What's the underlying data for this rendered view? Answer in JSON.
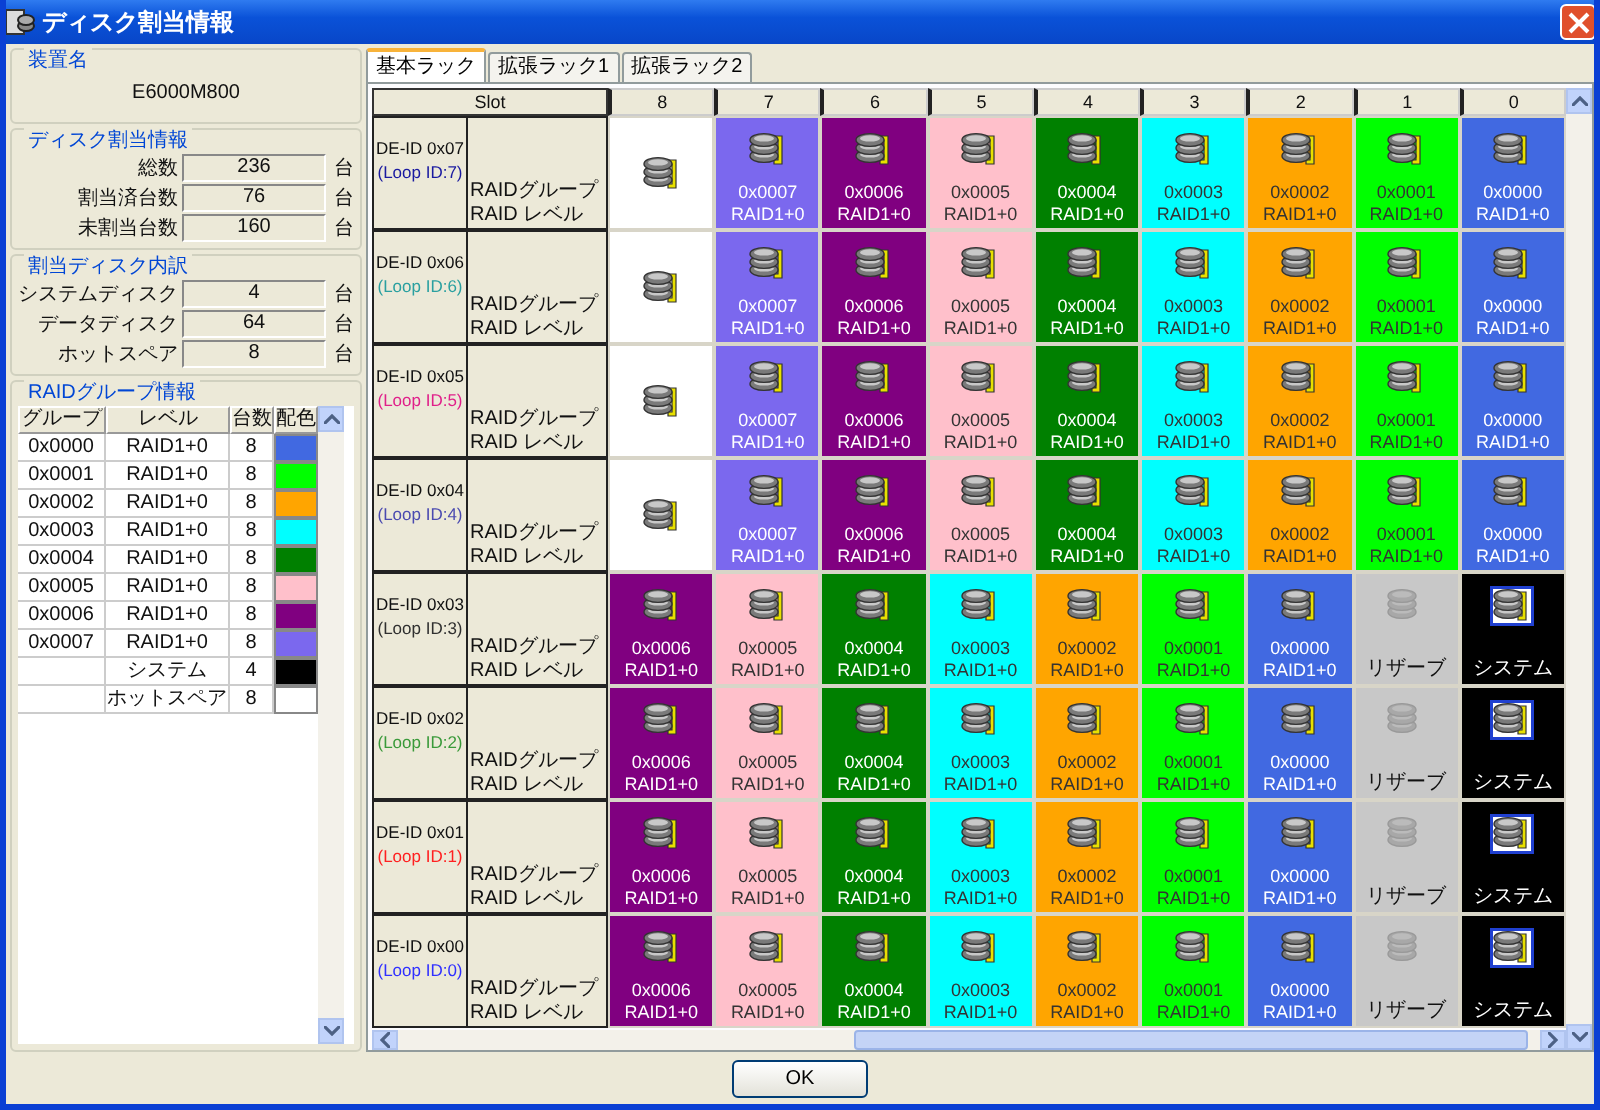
{
  "window": {
    "title": "ディスク割当情報"
  },
  "device": {
    "legend": "装置名",
    "name": "E6000M800"
  },
  "allocation": {
    "legend": "ディスク割当情報",
    "rows": [
      {
        "label": "総数",
        "value": "236",
        "unit": "台"
      },
      {
        "label": "割当済台数",
        "value": "76",
        "unit": "台"
      },
      {
        "label": "未割当台数",
        "value": "160",
        "unit": "台"
      }
    ]
  },
  "breakdown": {
    "legend": "割当ディスク内訳",
    "rows": [
      {
        "label": "システムディスク",
        "value": "4",
        "unit": "台"
      },
      {
        "label": "データディスク",
        "value": "64",
        "unit": "台"
      },
      {
        "label": "ホットスペア",
        "value": "8",
        "unit": "台"
      }
    ]
  },
  "raid_groups": {
    "legend": "RAIDグループ情報",
    "columns": [
      "グループ",
      "レベル",
      "台数",
      "配色"
    ],
    "rows": [
      {
        "group": "0x0000",
        "level": "RAID1+0",
        "count": "8",
        "color": "#4169e1"
      },
      {
        "group": "0x0001",
        "level": "RAID1+0",
        "count": "8",
        "color": "#00ff00"
      },
      {
        "group": "0x0002",
        "level": "RAID1+0",
        "count": "8",
        "color": "#ffa500"
      },
      {
        "group": "0x0003",
        "level": "RAID1+0",
        "count": "8",
        "color": "#00ffff"
      },
      {
        "group": "0x0004",
        "level": "RAID1+0",
        "count": "8",
        "color": "#008000"
      },
      {
        "group": "0x0005",
        "level": "RAID1+0",
        "count": "8",
        "color": "#ffc0cb"
      },
      {
        "group": "0x0006",
        "level": "RAID1+0",
        "count": "8",
        "color": "#800080"
      },
      {
        "group": "0x0007",
        "level": "RAID1+0",
        "count": "8",
        "color": "#7b68ee"
      },
      {
        "level": "システム",
        "count": "4",
        "color": "#000000"
      },
      {
        "level": "ホットスペア",
        "count": "8",
        "color": "#ffffff"
      }
    ]
  },
  "tabs": [
    {
      "label": "基本ラック",
      "selected": true
    },
    {
      "label": "拡張ラック1",
      "selected": false
    },
    {
      "label": "拡張ラック2",
      "selected": false
    }
  ],
  "grid": {
    "slot_header": "Slot",
    "columns": [
      "8",
      "7",
      "6",
      "5",
      "4",
      "3",
      "2",
      "1",
      "0"
    ],
    "rows": [
      {
        "de_id": "DE-ID 0x07",
        "loop_id": "(Loop ID:7)",
        "color": "#1a1aa0",
        "group_label": "RAIDグループ",
        "level_label": "RAID レベル",
        "cells": [
          {
            "kind": "empty",
            "color": "#ffffff"
          },
          {
            "kind": "raid",
            "color": "#7b68ee",
            "group": "0x0007",
            "level": "RAID1+0"
          },
          {
            "kind": "raid",
            "color": "#800080",
            "group": "0x0006",
            "level": "RAID1+0"
          },
          {
            "kind": "raid",
            "color": "#ffc0cb",
            "group": "0x0005",
            "level": "RAID1+0"
          },
          {
            "kind": "raid",
            "color": "#008000",
            "group": "0x0004",
            "level": "RAID1+0"
          },
          {
            "kind": "raid",
            "color": "#00ffff",
            "group": "0x0003",
            "level": "RAID1+0"
          },
          {
            "kind": "raid",
            "color": "#ffa500",
            "group": "0x0002",
            "level": "RAID1+0"
          },
          {
            "kind": "raid",
            "color": "#00ff00",
            "group": "0x0001",
            "level": "RAID1+0"
          },
          {
            "kind": "raid",
            "color": "#4169e1",
            "group": "0x0000",
            "level": "RAID1+0"
          }
        ]
      },
      {
        "de_id": "DE-ID 0x06",
        "loop_id": "(Loop ID:6)",
        "color": "#2aa0a0",
        "group_label": "RAIDグループ",
        "level_label": "RAID レベル",
        "cells": [
          {
            "kind": "empty",
            "color": "#ffffff"
          },
          {
            "kind": "raid",
            "color": "#7b68ee",
            "group": "0x0007",
            "level": "RAID1+0"
          },
          {
            "kind": "raid",
            "color": "#800080",
            "group": "0x0006",
            "level": "RAID1+0"
          },
          {
            "kind": "raid",
            "color": "#ffc0cb",
            "group": "0x0005",
            "level": "RAID1+0"
          },
          {
            "kind": "raid",
            "color": "#008000",
            "group": "0x0004",
            "level": "RAID1+0"
          },
          {
            "kind": "raid",
            "color": "#00ffff",
            "group": "0x0003",
            "level": "RAID1+0"
          },
          {
            "kind": "raid",
            "color": "#ffa500",
            "group": "0x0002",
            "level": "RAID1+0"
          },
          {
            "kind": "raid",
            "color": "#00ff00",
            "group": "0x0001",
            "level": "RAID1+0"
          },
          {
            "kind": "raid",
            "color": "#4169e1",
            "group": "0x0000",
            "level": "RAID1+0"
          }
        ]
      },
      {
        "de_id": "DE-ID 0x05",
        "loop_id": "(Loop ID:5)",
        "color": "#e0208a",
        "group_label": "RAIDグループ",
        "level_label": "RAID レベル",
        "cells": [
          {
            "kind": "empty",
            "color": "#ffffff"
          },
          {
            "kind": "raid",
            "color": "#7b68ee",
            "group": "0x0007",
            "level": "RAID1+0"
          },
          {
            "kind": "raid",
            "color": "#800080",
            "group": "0x0006",
            "level": "RAID1+0"
          },
          {
            "kind": "raid",
            "color": "#ffc0cb",
            "group": "0x0005",
            "level": "RAID1+0"
          },
          {
            "kind": "raid",
            "color": "#008000",
            "group": "0x0004",
            "level": "RAID1+0"
          },
          {
            "kind": "raid",
            "color": "#00ffff",
            "group": "0x0003",
            "level": "RAID1+0"
          },
          {
            "kind": "raid",
            "color": "#ffa500",
            "group": "0x0002",
            "level": "RAID1+0"
          },
          {
            "kind": "raid",
            "color": "#00ff00",
            "group": "0x0001",
            "level": "RAID1+0"
          },
          {
            "kind": "raid",
            "color": "#4169e1",
            "group": "0x0000",
            "level": "RAID1+0"
          }
        ]
      },
      {
        "de_id": "DE-ID 0x04",
        "loop_id": "(Loop ID:4)",
        "color": "#4a4ab0",
        "group_label": "RAIDグループ",
        "level_label": "RAID レベル",
        "cells": [
          {
            "kind": "empty",
            "color": "#ffffff"
          },
          {
            "kind": "raid",
            "color": "#7b68ee",
            "group": "0x0007",
            "level": "RAID1+0"
          },
          {
            "kind": "raid",
            "color": "#800080",
            "group": "0x0006",
            "level": "RAID1+0"
          },
          {
            "kind": "raid",
            "color": "#ffc0cb",
            "group": "0x0005",
            "level": "RAID1+0"
          },
          {
            "kind": "raid",
            "color": "#008000",
            "group": "0x0004",
            "level": "RAID1+0"
          },
          {
            "kind": "raid",
            "color": "#00ffff",
            "group": "0x0003",
            "level": "RAID1+0"
          },
          {
            "kind": "raid",
            "color": "#ffa500",
            "group": "0x0002",
            "level": "RAID1+0"
          },
          {
            "kind": "raid",
            "color": "#00ff00",
            "group": "0x0001",
            "level": "RAID1+0"
          },
          {
            "kind": "raid",
            "color": "#4169e1",
            "group": "0x0000",
            "level": "RAID1+0"
          }
        ]
      },
      {
        "de_id": "DE-ID 0x03",
        "loop_id": "(Loop ID:3)",
        "color": "#303030",
        "group_label": "RAIDグループ",
        "level_label": "RAID レベル",
        "cells": [
          {
            "kind": "raid",
            "color": "#800080",
            "group": "0x0006",
            "level": "RAID1+0"
          },
          {
            "kind": "raid",
            "color": "#ffc0cb",
            "group": "0x0005",
            "level": "RAID1+0"
          },
          {
            "kind": "raid",
            "color": "#008000",
            "group": "0x0004",
            "level": "RAID1+0"
          },
          {
            "kind": "raid",
            "color": "#00ffff",
            "group": "0x0003",
            "level": "RAID1+0"
          },
          {
            "kind": "raid",
            "color": "#ffa500",
            "group": "0x0002",
            "level": "RAID1+0"
          },
          {
            "kind": "raid",
            "color": "#00ff00",
            "group": "0x0001",
            "level": "RAID1+0"
          },
          {
            "kind": "raid",
            "color": "#4169e1",
            "group": "0x0000",
            "level": "RAID1+0"
          },
          {
            "kind": "reserve",
            "color": "#c8c8c8",
            "label": "リザーブ"
          },
          {
            "kind": "system",
            "color": "#000000",
            "label": "システム"
          }
        ]
      },
      {
        "de_id": "DE-ID 0x02",
        "loop_id": "(Loop ID:2)",
        "color": "#3a9a3a",
        "group_label": "RAIDグループ",
        "level_label": "RAID レベル",
        "cells": [
          {
            "kind": "raid",
            "color": "#800080",
            "group": "0x0006",
            "level": "RAID1+0"
          },
          {
            "kind": "raid",
            "color": "#ffc0cb",
            "group": "0x0005",
            "level": "RAID1+0"
          },
          {
            "kind": "raid",
            "color": "#008000",
            "group": "0x0004",
            "level": "RAID1+0"
          },
          {
            "kind": "raid",
            "color": "#00ffff",
            "group": "0x0003",
            "level": "RAID1+0"
          },
          {
            "kind": "raid",
            "color": "#ffa500",
            "group": "0x0002",
            "level": "RAID1+0"
          },
          {
            "kind": "raid",
            "color": "#00ff00",
            "group": "0x0001",
            "level": "RAID1+0"
          },
          {
            "kind": "raid",
            "color": "#4169e1",
            "group": "0x0000",
            "level": "RAID1+0"
          },
          {
            "kind": "reserve",
            "color": "#c8c8c8",
            "label": "リザーブ"
          },
          {
            "kind": "system",
            "color": "#000000",
            "label": "システム"
          }
        ]
      },
      {
        "de_id": "DE-ID 0x01",
        "loop_id": "(Loop ID:1)",
        "color": "#ff2020",
        "group_label": "RAIDグループ",
        "level_label": "RAID レベル",
        "cells": [
          {
            "kind": "raid",
            "color": "#800080",
            "group": "0x0006",
            "level": "RAID1+0"
          },
          {
            "kind": "raid",
            "color": "#ffc0cb",
            "group": "0x0005",
            "level": "RAID1+0"
          },
          {
            "kind": "raid",
            "color": "#008000",
            "group": "0x0004",
            "level": "RAID1+0"
          },
          {
            "kind": "raid",
            "color": "#00ffff",
            "group": "0x0003",
            "level": "RAID1+0"
          },
          {
            "kind": "raid",
            "color": "#ffa500",
            "group": "0x0002",
            "level": "RAID1+0"
          },
          {
            "kind": "raid",
            "color": "#00ff00",
            "group": "0x0001",
            "level": "RAID1+0"
          },
          {
            "kind": "raid",
            "color": "#4169e1",
            "group": "0x0000",
            "level": "RAID1+0"
          },
          {
            "kind": "reserve",
            "color": "#c8c8c8",
            "label": "リザーブ"
          },
          {
            "kind": "system",
            "color": "#000000",
            "label": "システム"
          }
        ]
      },
      {
        "de_id": "DE-ID 0x00",
        "loop_id": "(Loop ID:0)",
        "color": "#3030ff",
        "group_label": "RAIDグループ",
        "level_label": "RAID レベル",
        "cells": [
          {
            "kind": "raid",
            "color": "#800080",
            "group": "0x0006",
            "level": "RAID1+0"
          },
          {
            "kind": "raid",
            "color": "#ffc0cb",
            "group": "0x0005",
            "level": "RAID1+0"
          },
          {
            "kind": "raid",
            "color": "#008000",
            "group": "0x0004",
            "level": "RAID1+0"
          },
          {
            "kind": "raid",
            "color": "#00ffff",
            "group": "0x0003",
            "level": "RAID1+0"
          },
          {
            "kind": "raid",
            "color": "#ffa500",
            "group": "0x0002",
            "level": "RAID1+0"
          },
          {
            "kind": "raid",
            "color": "#00ff00",
            "group": "0x0001",
            "level": "RAID1+0"
          },
          {
            "kind": "raid",
            "color": "#4169e1",
            "group": "0x0000",
            "level": "RAID1+0"
          },
          {
            "kind": "reserve",
            "color": "#c8c8c8",
            "label": "リザーブ"
          },
          {
            "kind": "system",
            "color": "#000000",
            "label": "システム"
          }
        ]
      }
    ]
  },
  "ok_button": "OK"
}
